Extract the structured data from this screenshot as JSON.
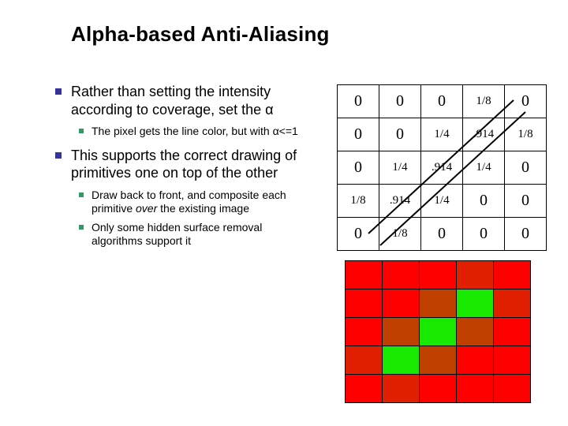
{
  "title": "Alpha-based Anti-Aliasing",
  "points": {
    "p1": "Rather than setting the intensity according to coverage, set the α",
    "p1_sub1": "The pixel gets the line color, but with α<=1",
    "p2": "This supports the correct drawing of primitives one on top of the other",
    "p2_sub1_a": "Draw back to front, and composite each primitive ",
    "p2_sub1_b": "over",
    "p2_sub1_c": " the existing image",
    "p2_sub2": "Only some hidden surface removal algorithms support it"
  },
  "grid": {
    "r0": {
      "c0": "0",
      "c1": "0",
      "c2": "0",
      "c3": "1/8",
      "c4": "0"
    },
    "r1": {
      "c0": "0",
      "c1": "0",
      "c2": "1/4",
      "c3": ".914",
      "c4": "1/8"
    },
    "r2": {
      "c0": "0",
      "c1": "1/4",
      "c2": ".914",
      "c3": "1/4",
      "c4": "0"
    },
    "r3": {
      "c0": "1/8",
      "c1": ".914",
      "c2": "1/4",
      "c3": "0",
      "c4": "0"
    },
    "r4": {
      "c0": "0",
      "c1": "1/8",
      "c2": "0",
      "c3": "0",
      "c4": "0"
    }
  },
  "colors": {
    "r0": [
      "#FF0000",
      "#FF0000",
      "#FF0000",
      "#E02000",
      "#FF0000"
    ],
    "r1": [
      "#FF0000",
      "#FF0000",
      "#C04000",
      "#17E900",
      "#E02000"
    ],
    "r2": [
      "#FF0000",
      "#C04000",
      "#17E900",
      "#C04000",
      "#FF0000"
    ],
    "r3": [
      "#E02000",
      "#17E900",
      "#C04000",
      "#FF0000",
      "#FF0000"
    ],
    "r4": [
      "#FF0000",
      "#E02000",
      "#FF0000",
      "#FF0000",
      "#FF0000"
    ]
  },
  "chart_data": {
    "type": "table",
    "title": "Pixel alpha coverage values for anti-aliased line",
    "rows": [
      [
        "0",
        "0",
        "0",
        "1/8",
        "0"
      ],
      [
        "0",
        "0",
        "1/4",
        ".914",
        "1/8"
      ],
      [
        "0",
        "1/4",
        ".914",
        "1/4",
        "0"
      ],
      [
        "1/8",
        ".914",
        "1/4",
        "0",
        "0"
      ],
      [
        "0",
        "1/8",
        "0",
        "0",
        "0"
      ]
    ]
  }
}
